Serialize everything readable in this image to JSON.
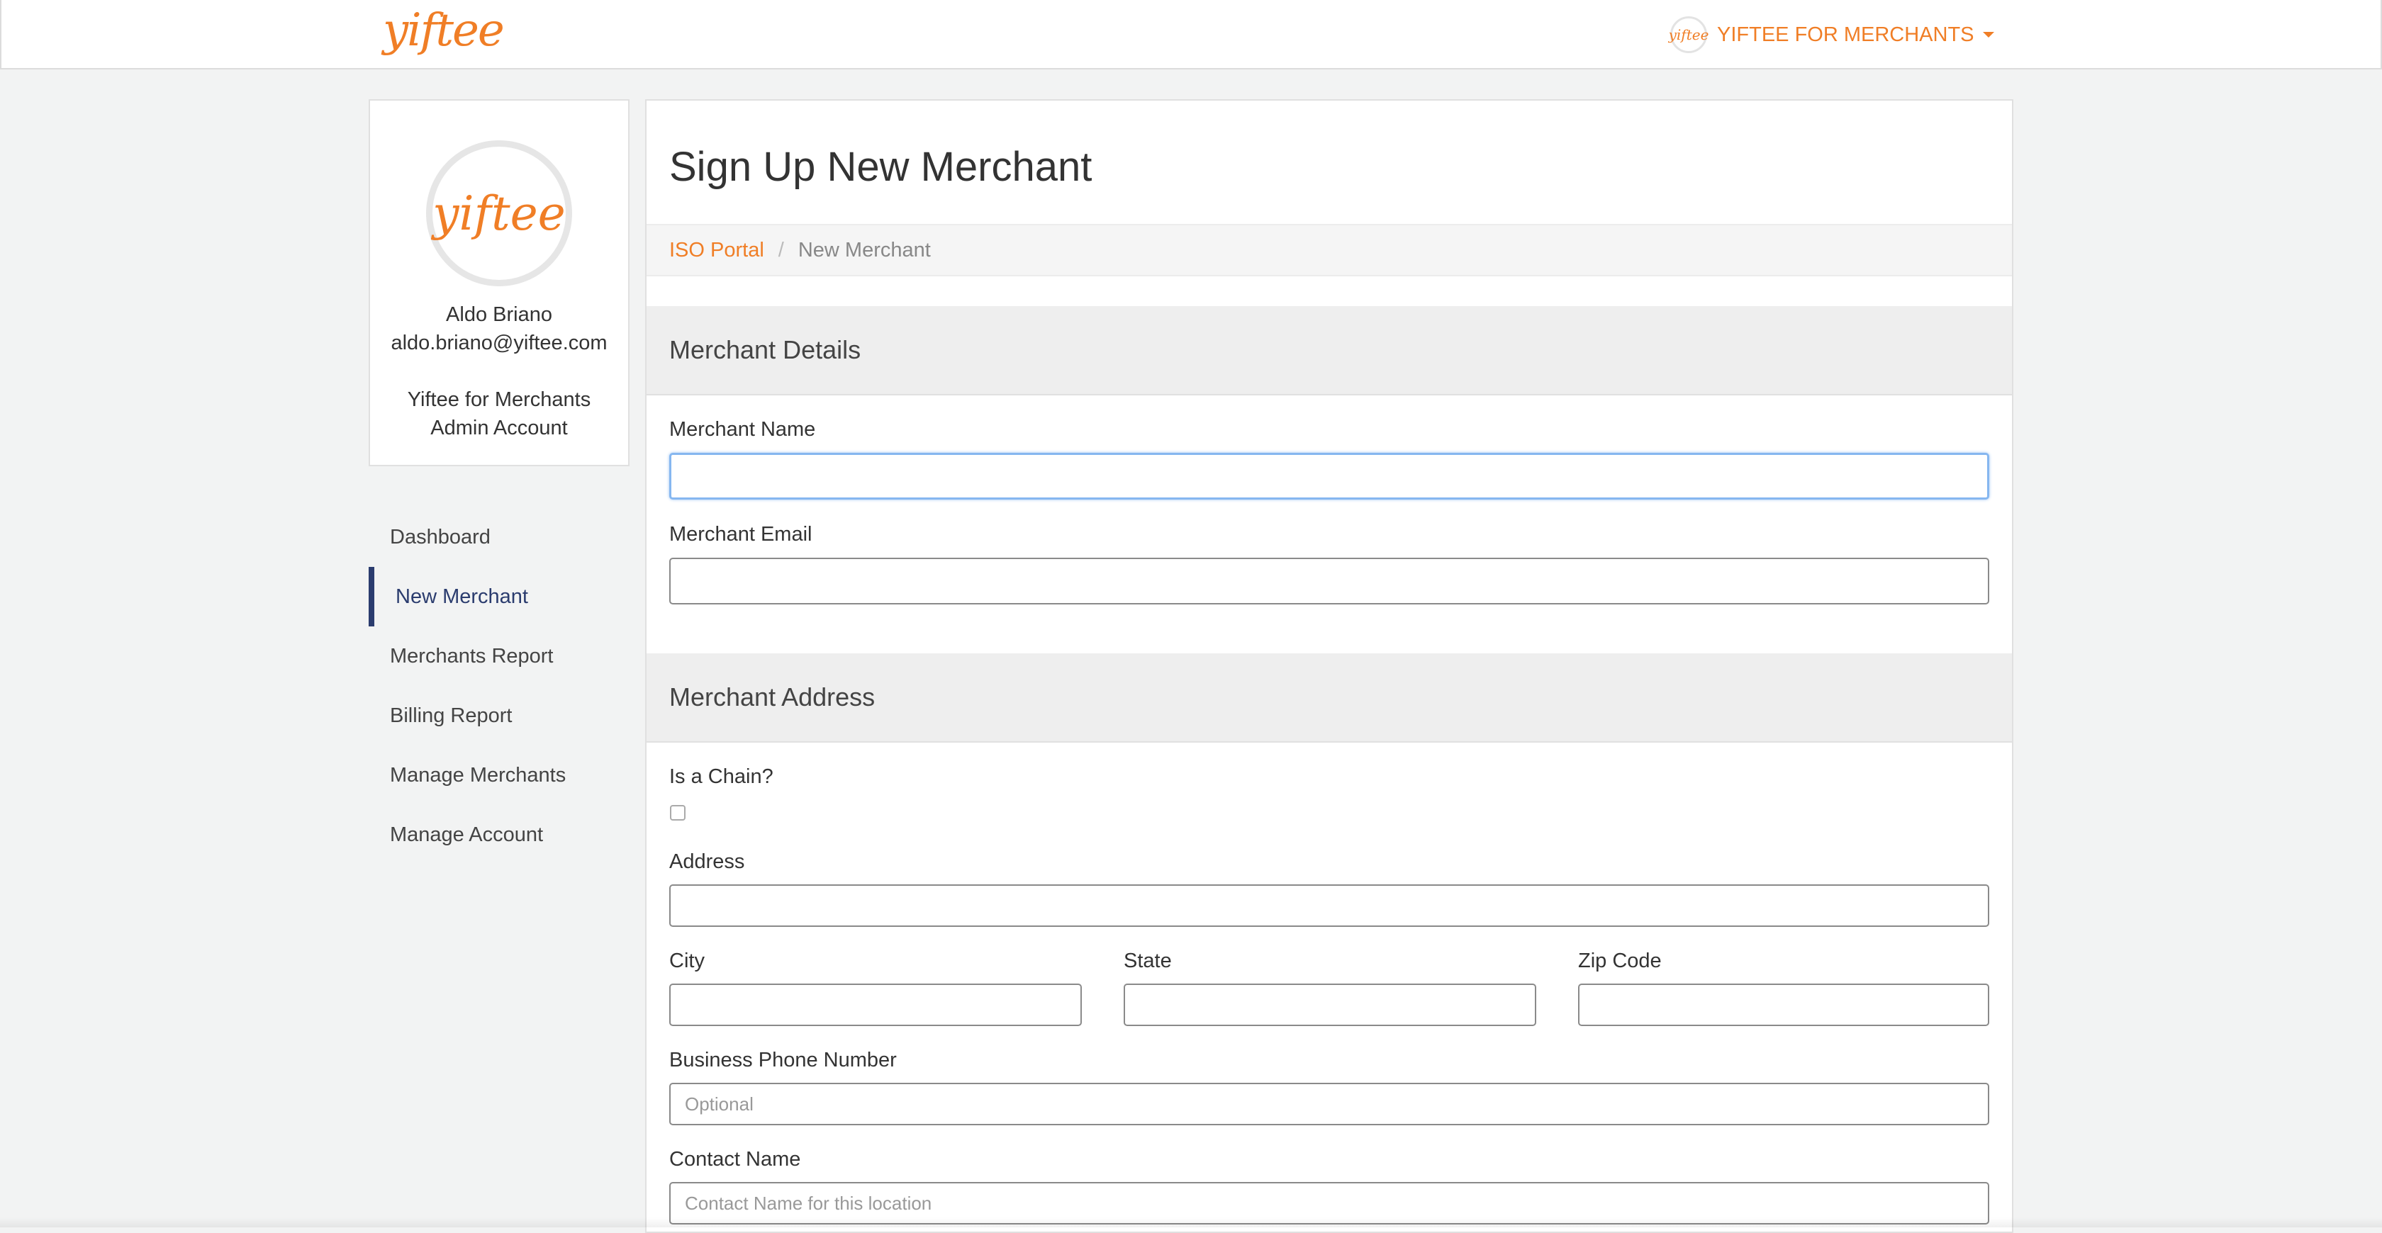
{
  "navbar": {
    "logo_text": "yiftee",
    "avatar_text": "yiftee",
    "account_menu_label": "YIFTEE FOR MERCHANTS"
  },
  "profile": {
    "avatar_text": "yiftee",
    "name": "Aldo Briano",
    "email": "aldo.briano@yiftee.com",
    "account_line1": "Yiftee for Merchants",
    "account_line2": "Admin Account"
  },
  "sidebar": {
    "items": [
      {
        "label": "Dashboard",
        "active": false
      },
      {
        "label": "New Merchant",
        "active": true
      },
      {
        "label": "Merchants Report",
        "active": false
      },
      {
        "label": "Billing Report",
        "active": false
      },
      {
        "label": "Manage Merchants",
        "active": false
      },
      {
        "label": "Manage Account",
        "active": false
      }
    ]
  },
  "main": {
    "title": "Sign Up New Merchant",
    "breadcrumb": {
      "link": "ISO Portal",
      "separator": "/",
      "current": "New Merchant"
    },
    "merchant_details": {
      "heading": "Merchant Details",
      "name_label": "Merchant Name",
      "name_value": "",
      "email_label": "Merchant Email",
      "email_value": ""
    },
    "merchant_address": {
      "heading": "Merchant Address",
      "chain_label": "Is a Chain?",
      "chain_checked": false,
      "address_label": "Address",
      "city_label": "City",
      "state_label": "State",
      "zip_label": "Zip Code",
      "phone_label": "Business Phone Number",
      "phone_placeholder": "Optional",
      "contact_label": "Contact Name",
      "contact_placeholder": "Contact Name for this location"
    }
  },
  "colors": {
    "brand_orange": "#f07e26",
    "active_nav": "#2b3c6e",
    "focus_blue": "#86b7f0"
  }
}
